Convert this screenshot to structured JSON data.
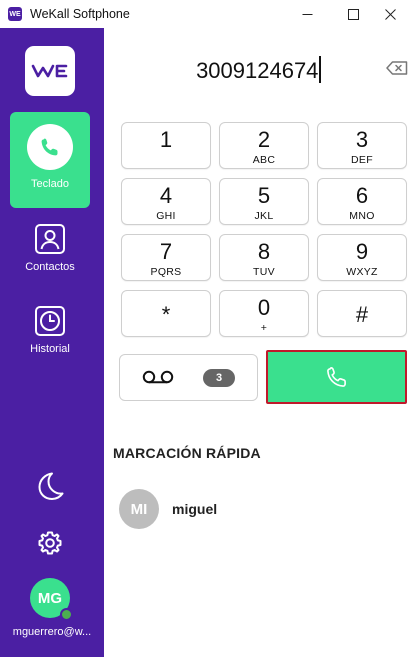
{
  "window": {
    "title": "WeKall Softphone",
    "app_icon_text": "WE"
  },
  "sidebar": {
    "logo_text": "WE",
    "items": [
      {
        "label": "Teclado",
        "icon": "phone-icon",
        "active": true
      },
      {
        "label": "Contactos",
        "icon": "contact-card-icon",
        "active": false
      },
      {
        "label": "Historial",
        "icon": "clock-icon",
        "active": false
      }
    ],
    "theme_icon": "moon-icon",
    "settings_icon": "gear-icon",
    "user": {
      "initials": "MG",
      "email": "mguerrero@w...",
      "status": "online"
    }
  },
  "dialer": {
    "number": "3009124674",
    "keys": [
      {
        "digit": "1",
        "letters": ""
      },
      {
        "digit": "2",
        "letters": "ABC"
      },
      {
        "digit": "3",
        "letters": "DEF"
      },
      {
        "digit": "4",
        "letters": "GHI"
      },
      {
        "digit": "5",
        "letters": "JKL"
      },
      {
        "digit": "6",
        "letters": "MNO"
      },
      {
        "digit": "7",
        "letters": "PQRS"
      },
      {
        "digit": "8",
        "letters": "TUV"
      },
      {
        "digit": "9",
        "letters": "WXYZ"
      },
      {
        "digit": "*",
        "letters": ""
      },
      {
        "digit": "0",
        "letters": "+"
      },
      {
        "digit": "#",
        "letters": ""
      }
    ],
    "voicemail_count": "3"
  },
  "speed_dial": {
    "title": "MARCACIÓN RÁPIDA",
    "contacts": [
      {
        "initials": "MI",
        "name": "miguel"
      }
    ]
  },
  "colors": {
    "sidebar": "#4b1fa3",
    "accent_green": "#3ae08e",
    "call_button_border": "#c0192b"
  }
}
